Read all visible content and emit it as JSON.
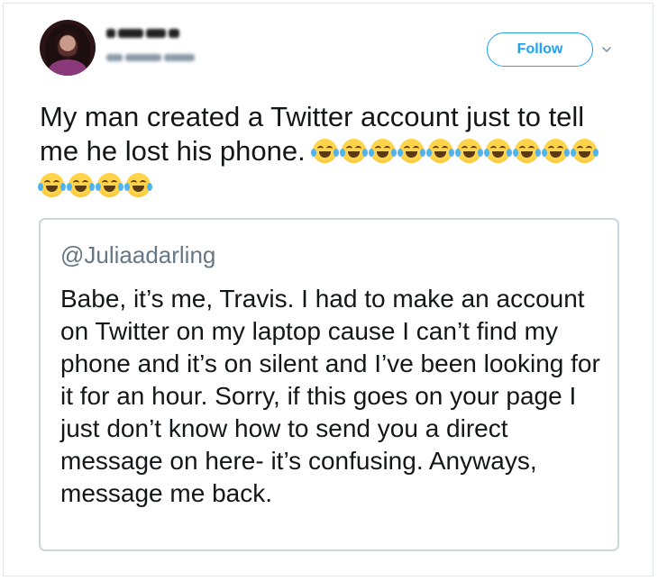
{
  "author": {
    "avatar_icon": "profile-photo"
  },
  "actions": {
    "follow_label": "Follow",
    "more_icon": "chevron-down-icon"
  },
  "tweet": {
    "text": "My man created a Twitter account just to tell me he lost his phone.",
    "emoji_count": 14,
    "emoji_name": "face-with-tears-of-joy"
  },
  "quoted": {
    "handle": "@Juliaadarling",
    "text": "Babe, it’s me, Travis. I had to make an account on Twitter on my laptop cause I can’t find my phone and it’s on silent and I’ve been looking for it for an hour. Sorry, if this goes on your page I just don’t know how to send you a direct message on here- it’s confusing. Anyways, message me back."
  },
  "colors": {
    "accent": "#1da1f2",
    "text": "#14171a",
    "secondary_text": "#657786",
    "border": "#ccd6dd"
  }
}
